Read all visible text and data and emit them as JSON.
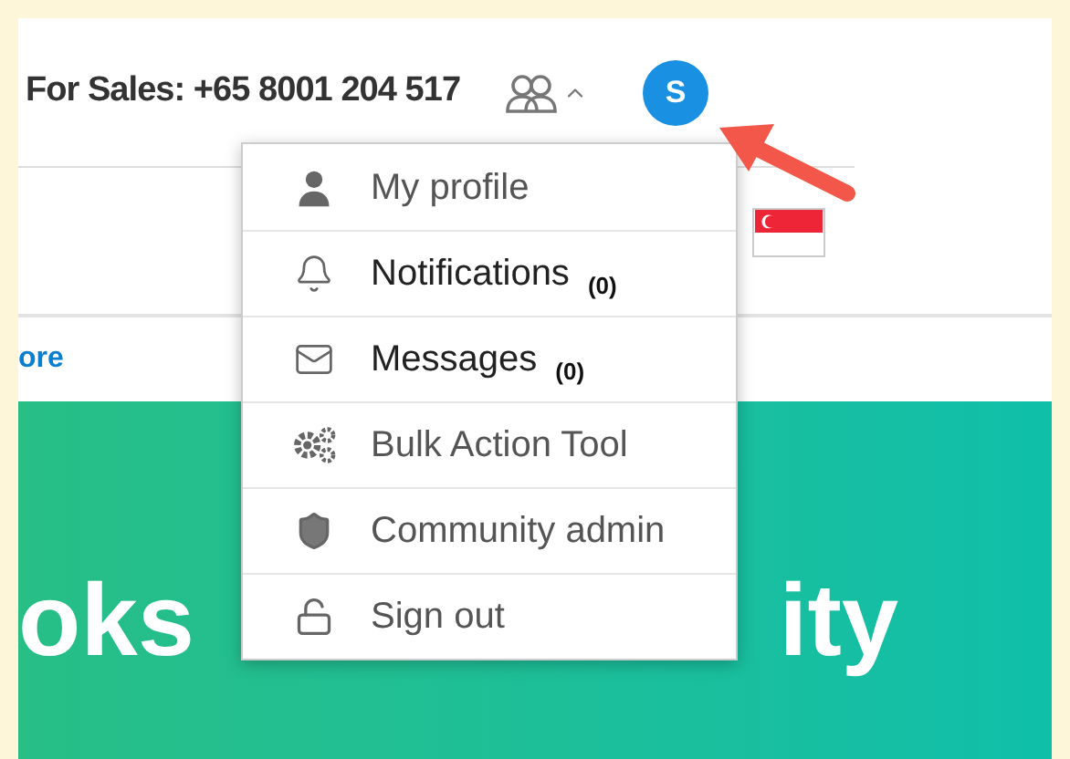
{
  "header": {
    "sales": "For Sales: +65 8001 204 517",
    "menu_expanded": true,
    "avatar": "S"
  },
  "nav": {
    "link": "ore"
  },
  "hero": {
    "title_parts": [
      "oks",
      "ity"
    ]
  },
  "menu": [
    {
      "kind": "profile",
      "label": "My profile"
    },
    {
      "kind": "notifications",
      "label": "Notifications",
      "count": "(0)"
    },
    {
      "kind": "messages",
      "label": "Messages",
      "count": "(0)"
    },
    {
      "kind": "bulk",
      "label": "Bulk Action Tool"
    },
    {
      "kind": "admin",
      "label": "Community admin"
    },
    {
      "kind": "signout",
      "label": "Sign out"
    }
  ]
}
